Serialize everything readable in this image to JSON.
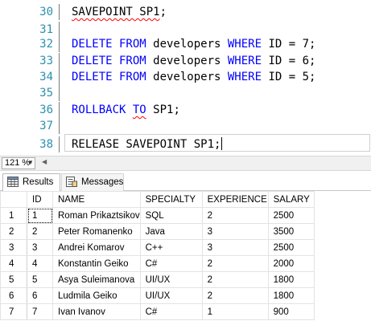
{
  "editor": {
    "lines": [
      {
        "num": "30",
        "tokens": [
          {
            "t": "SAVEPOINT SP1",
            "c": "wav"
          },
          {
            "t": ";",
            "c": ""
          }
        ]
      },
      {
        "num": "31",
        "tokens": []
      },
      {
        "num": "32",
        "tokens": [
          {
            "t": "DELETE FROM",
            "c": "kw"
          },
          {
            "t": " developers ",
            "c": ""
          },
          {
            "t": "WHERE",
            "c": "kw"
          },
          {
            "t": " ID ",
            "c": ""
          },
          {
            "t": "=",
            "c": ""
          },
          {
            "t": " 7;",
            "c": ""
          }
        ]
      },
      {
        "num": "33",
        "tokens": [
          {
            "t": "DELETE FROM",
            "c": "kw"
          },
          {
            "t": " developers ",
            "c": ""
          },
          {
            "t": "WHERE",
            "c": "kw"
          },
          {
            "t": " ID ",
            "c": ""
          },
          {
            "t": "=",
            "c": ""
          },
          {
            "t": " 6;",
            "c": ""
          }
        ]
      },
      {
        "num": "34",
        "tokens": [
          {
            "t": "DELETE FROM",
            "c": "kw"
          },
          {
            "t": " developers ",
            "c": ""
          },
          {
            "t": "WHERE",
            "c": "kw"
          },
          {
            "t": " ID ",
            "c": ""
          },
          {
            "t": "=",
            "c": ""
          },
          {
            "t": " 5;",
            "c": ""
          }
        ]
      },
      {
        "num": "35",
        "tokens": []
      },
      {
        "num": "36",
        "tokens": [
          {
            "t": "ROLLBACK",
            "c": "kw"
          },
          {
            "t": " ",
            "c": ""
          },
          {
            "t": "TO",
            "c": "kw wav"
          },
          {
            "t": " SP1;",
            "c": ""
          }
        ]
      },
      {
        "num": "37",
        "tokens": []
      },
      {
        "num": "38",
        "tokens": [
          {
            "t": "RELEASE SAVEPOINT SP1",
            "c": ""
          },
          {
            "t": ";",
            "c": ""
          }
        ]
      }
    ]
  },
  "zoom": {
    "value": "121 %"
  },
  "tabs": {
    "results": "Results",
    "messages": "Messages"
  },
  "grid": {
    "columns": [
      "",
      "ID",
      "NAME",
      "SPECIALTY",
      "EXPERIENCE",
      "SALARY"
    ],
    "rows": [
      [
        "1",
        "1",
        "Roman Prikaztsikov",
        "SQL",
        "2",
        "2500"
      ],
      [
        "2",
        "2",
        "Peter Romanenko",
        "Java",
        "3",
        "3500"
      ],
      [
        "3",
        "3",
        "Andrei Komarov",
        "C++",
        "3",
        "2500"
      ],
      [
        "4",
        "4",
        "Konstantin Geiko",
        "C#",
        "2",
        "2000"
      ],
      [
        "5",
        "5",
        "Asya Suleimanova",
        "UI/UX",
        "2",
        "1800"
      ],
      [
        "6",
        "6",
        "Ludmila Geiko",
        "UI/UX",
        "2",
        "1800"
      ],
      [
        "7",
        "7",
        "Ivan Ivanov",
        "C#",
        "1",
        "900"
      ]
    ]
  }
}
